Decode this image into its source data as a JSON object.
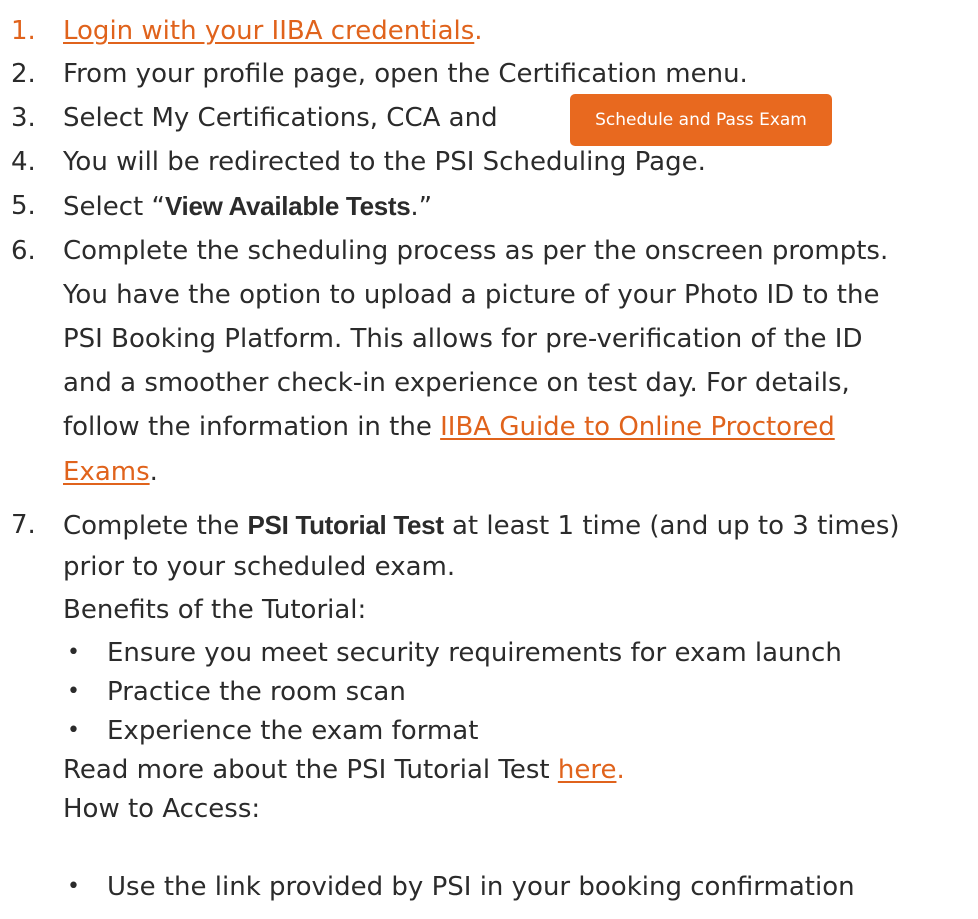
{
  "steps": [
    {
      "num": "1.",
      "link": "Login with your IIBA credentials",
      "after": "."
    },
    {
      "num": "2.",
      "text": "From your profile page, open the Certification menu."
    },
    {
      "num": "3.",
      "text": "Select My Certifications, CCA and",
      "button": "Schedule and Pass Exam"
    },
    {
      "num": "4.",
      "text": "You will be redirected to the PSI Scheduling Page."
    },
    {
      "num": "5.",
      "before": "Select “",
      "bold": "View Available Tests",
      "after": ".”"
    },
    {
      "num": "6.",
      "lines": [
        "Complete the scheduling process as per the onscreen prompts.",
        "You have the option to upload a picture of your Photo ID to the",
        "PSI Booking Platform. This allows for pre-verification of the ID",
        "and a smoother check-in experience on test day. For details,"
      ],
      "line5_before": "follow the information in the ",
      "link_part1": "IIBA Guide to Online Proctored",
      "link_part2": "Exams",
      "link_after": "."
    },
    {
      "num": "7.",
      "before": "Complete the ",
      "bold": "PSI Tutorial Test",
      "after": " at least 1 time (and up to 3 times)",
      "line2": "prior to your scheduled exam.",
      "benefits_heading": "Benefits of the Tutorial:",
      "benefits": [
        "Ensure you meet security requirements for exam launch",
        "Practice the room scan",
        "Experience the exam format"
      ],
      "read_more_before": "Read more about the PSI Tutorial Test ",
      "read_more_link": "here",
      "read_more_after": ".",
      "access_heading": "How to Access:",
      "access": [
        "Use the link provided by PSI in your booking confirmation"
      ]
    }
  ],
  "colors": {
    "link": "#e0631c",
    "button_bg": "#e8691f",
    "text": "#2b2b2b"
  }
}
